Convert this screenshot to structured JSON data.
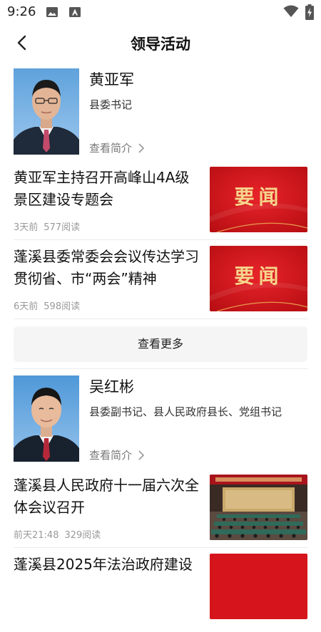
{
  "status": {
    "time": "9:26"
  },
  "header": {
    "title": "领导活动"
  },
  "leaders": [
    {
      "name": "黄亚军",
      "title": "县委书记",
      "profile_link": "查看简介"
    },
    {
      "name": "吴红彬",
      "title": "县委副书记、县人民政府县长、党组书记",
      "profile_link": "查看简介"
    }
  ],
  "news": [
    {
      "title": "黄亚军主持召开高峰山4A级景区建设专题会",
      "time": "3天前",
      "reads": "577阅读",
      "thumb_text": "要闻"
    },
    {
      "title": "蓬溪县委常委会会议传达学习贯彻省、市“两会”精神",
      "time": "6天前",
      "reads": "598阅读",
      "thumb_text": "要闻"
    },
    {
      "title": "蓬溪县人民政府十一届六次全体会议召开",
      "time": "前天21:48",
      "reads": "329阅读"
    },
    {
      "title": "蓬溪县2025年法治政府建设"
    }
  ],
  "more_button": "查看更多",
  "colors": {
    "accent_red": "#d6141b",
    "thumb_gold": "#f5d58c"
  }
}
